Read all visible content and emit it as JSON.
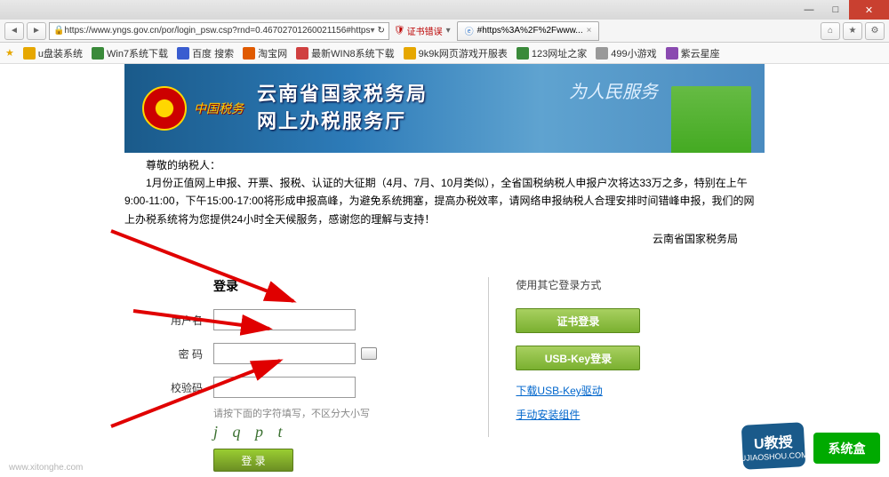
{
  "window": {
    "min": "—",
    "max": "□",
    "close": "✕"
  },
  "addr": {
    "url": "https://www.yngs.gov.cn/por/login_psw.csp?rnd=0.46702701260021156#https",
    "cert_error": "证书错误",
    "tab_title": "#https%3A%2F%2Fwww...",
    "tab_close": "×"
  },
  "bookmarks": [
    {
      "label": "u盘装系统",
      "color": "#e6a700"
    },
    {
      "label": "Win7系统下载",
      "color": "#3a8a3a"
    },
    {
      "label": "百度 搜索",
      "color": "#3a5dd0"
    },
    {
      "label": "淘宝网",
      "color": "#e05a00"
    },
    {
      "label": "最新WIN8系统下载",
      "color": "#d04040"
    },
    {
      "label": "9k9k网页游戏开服表",
      "color": "#e6a700"
    },
    {
      "label": "123网址之家",
      "color": "#3a8a3a"
    },
    {
      "label": "499小游戏",
      "color": "#999"
    },
    {
      "label": "紫云星座",
      "color": "#8a4ab0"
    }
  ],
  "banner": {
    "seal_text": "中国税务",
    "title_l1": "云南省国家税务局",
    "title_l2": "网上办税服务厅",
    "calligraphy": "为人民服务"
  },
  "notice": {
    "greeting": "尊敬的纳税人：",
    "body": "1月份正值网上申报、开票、报税、认证的大征期（4月、7月、10月类似），全省国税纳税人申报户次将达33万之多，特别在上午9:00-11:00，下午15:00-17:00将形成申报高峰，为避免系统拥塞，提高办税效率，请网络申报纳税人合理安排时间错峰申报，我们的网上办税系统将为您提供24小时全天候服务，感谢您的理解与支持！",
    "signature": "云南省国家税务局"
  },
  "login": {
    "title": "登录",
    "user_label": "用户名",
    "pwd_label": "密 码",
    "cap_label": "校验码",
    "cap_hint": "请按下面的字符填写，不区分大小写",
    "cap_text": "j q p t",
    "submit": "登 录"
  },
  "alt": {
    "title": "使用其它登录方式",
    "cert_btn": "证书登录",
    "usb_btn": "USB-Key登录",
    "link1": "下载USB-Key驱动",
    "link2": "手动安装组件"
  },
  "wm": {
    "left": "www.xitonghe.com",
    "badge1_big": "U教授",
    "badge1_small": "UJIAOSHOU.COM",
    "badge2": "系统盒"
  }
}
